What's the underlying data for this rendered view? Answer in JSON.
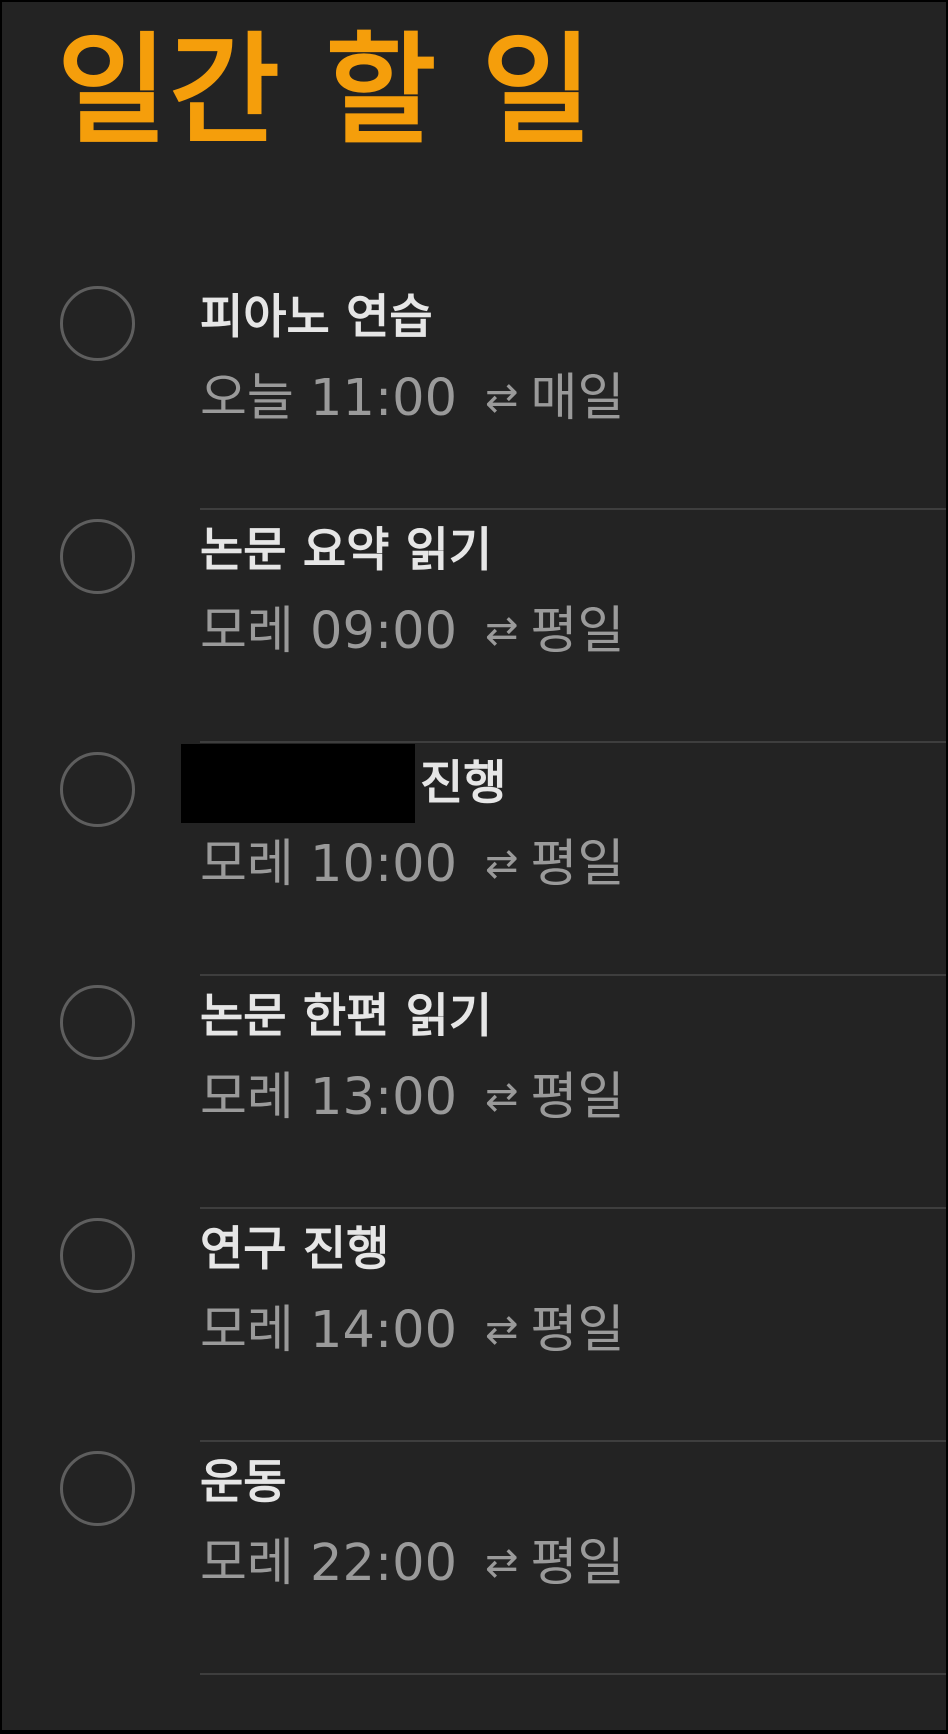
{
  "title": "일간 할 일",
  "items": [
    {
      "name": "피아노 연습",
      "when": "오늘 11:00",
      "repeat": "매일"
    },
    {
      "name": "논문 요약 읽기",
      "when": "모레 09:00",
      "repeat": "평일"
    },
    {
      "name": "진행",
      "when": "모레 10:00",
      "repeat": "평일"
    },
    {
      "name": "논문 한편 읽기",
      "when": "모레 13:00",
      "repeat": "평일"
    },
    {
      "name": "연구 진행",
      "when": "모레 14:00",
      "repeat": "평일"
    },
    {
      "name": "운동",
      "when": "모레 22:00",
      "repeat": "평일"
    }
  ],
  "icons": {
    "repeat": "repeat-icon",
    "checkbox": "circle-checkbox-icon"
  },
  "colors": {
    "accent": "#F59E0B",
    "background": "#232323",
    "primary_text": "#E6E6E6",
    "secondary_text": "#9A9A9A"
  }
}
